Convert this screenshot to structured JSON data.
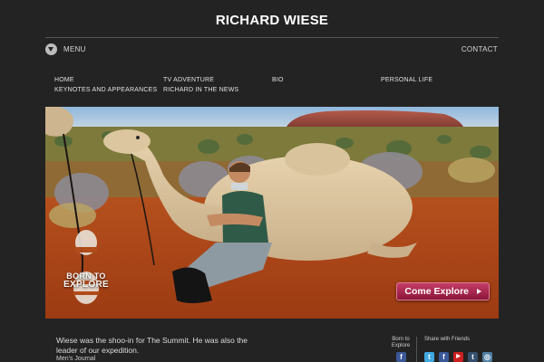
{
  "header": {
    "title": "RICHARD WIESE"
  },
  "topbar": {
    "menu_label": "MENU",
    "contact_label": "CONTACT",
    "menu_icon": "download-circle-icon"
  },
  "nav": {
    "items": [
      {
        "label": "HOME"
      },
      {
        "label": "TV ADVENTURE"
      },
      {
        "label": "BIO"
      },
      {
        "label": "PERSONAL LIFE"
      },
      {
        "label": "KEYNOTES AND APPEARANCES"
      },
      {
        "label": "RICHARD IN THE NEWS"
      }
    ]
  },
  "hero": {
    "cta_label": "Come Explore",
    "logo_line1": "BORN TO",
    "logo_line2": "EXPLORE",
    "accent_color": "#a21f48"
  },
  "quote": {
    "text": "Wiese was the shoo-in for The Summit. He was also the leader of our expedition.",
    "source": "Men's Journal"
  },
  "social": {
    "born_label": "Born to Explore",
    "share_label": "Share with Friends",
    "icons": {
      "facebook": "f",
      "twitter": "t",
      "facebook2": "f",
      "youtube": "▶",
      "tumblr": "t",
      "instagram": "◎"
    },
    "colors": {
      "facebook": "#3b5998",
      "twitter": "#3fa9e0",
      "youtube": "#cc2020",
      "tumblr": "#35506e",
      "instagram": "#517fa4"
    }
  }
}
